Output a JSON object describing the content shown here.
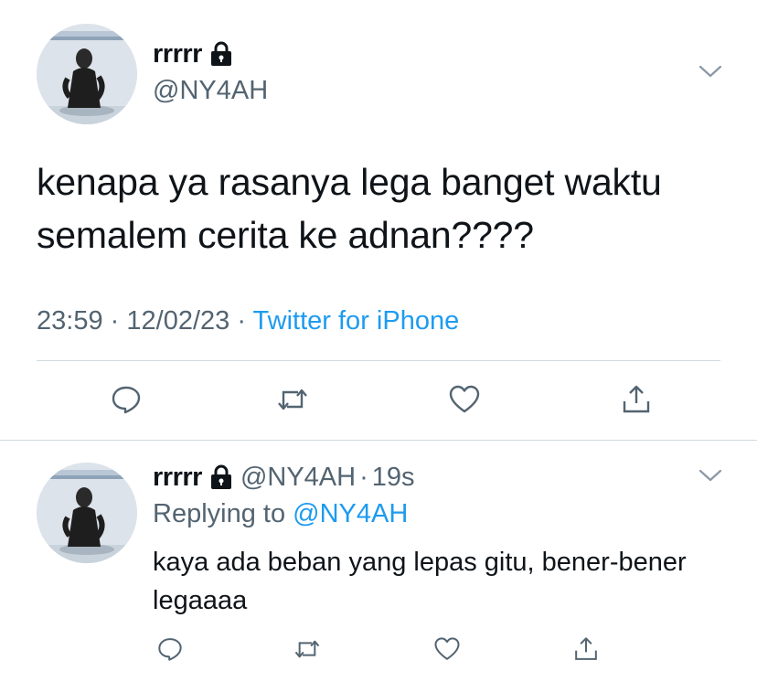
{
  "main_tweet": {
    "display_name": "rrrrr",
    "handle": "@NY4AH",
    "text": "kenapa ya rasanya lega banget waktu semalem cerita ke adnan????",
    "time": "23:59",
    "separator": "·",
    "date": "12/02/23",
    "source": "Twitter for iPhone"
  },
  "reply_tweet": {
    "display_name": "rrrrr",
    "handle": "@NY4AH",
    "separator": "·",
    "relative_time": "19s",
    "replying_prefix": "Replying to",
    "replying_to": "@NY4AH",
    "text": "kaya ada beban yang lepas gitu, bener-bener legaaaa"
  },
  "icons": {
    "lock": "lock-icon",
    "chevron": "chevron-down-icon",
    "reply": "comment-icon",
    "retweet": "retweet-icon",
    "like": "heart-icon",
    "share": "share-icon"
  },
  "colors": {
    "text": "#0f1419",
    "secondary": "#536471",
    "link": "#1d9bf0",
    "divider": "#cfd9de"
  }
}
